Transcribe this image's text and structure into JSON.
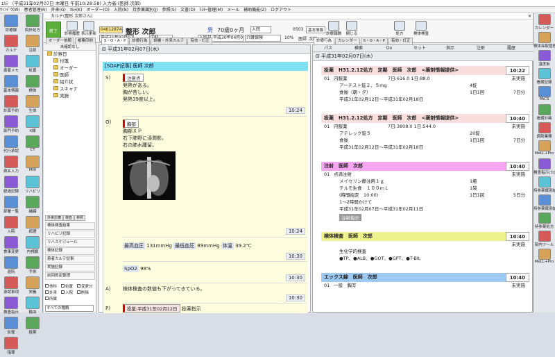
{
  "app": {
    "title": "ｴﾙﾃ （平成31年02月07日 木曜日 午前10:28:58) 入力者:(医師 次郎)",
    "menu": [
      "ｳｨﾝﾄﾞｳ(W)",
      "患者管理(R)",
      "外来(G)",
      "ｶﾙﾃ(K)",
      "オーダー(O)",
      "入院(N)",
      "持参薬識別(J)",
      "参照(S)",
      "文書(D)",
      "ﾏｽﾀｰ管理(M)",
      "メール",
      "補助機能(Z)",
      "ログアウト"
    ]
  },
  "left_tools": [
    "診療録",
    "院外処方",
    "カルテ",
    "注射",
    "患者メモ",
    "処置",
    "基本情報",
    "検体",
    "計算予約",
    "生体",
    "部門予約",
    "X線",
    "代行承認",
    "CT",
    "病名入力",
    "MRI",
    "経過記録",
    "リハビリ",
    "部署一覧",
    "補綴",
    "入院",
    "病理",
    "食事変更",
    "内視鏡",
    "退院",
    "手術",
    "承認事項",
    "栄養",
    "検査指示",
    "輸血",
    "反復",
    "投薬",
    "指導"
  ],
  "right_tools": [
    "カレンダー",
    "検体採取管理",
    "温度板",
    "看護記録",
    "PACS",
    "看護計画",
    "調剤業務",
    "MeLL+Pro",
    "検査指示(カ)",
    "持参薬識別結果",
    "持参薬識別結果中止",
    "持参薬処方",
    "院内ツール",
    "MeLL+Pro"
  ],
  "window": {
    "title": "カルテ(整形 次郎さん)"
  },
  "patient": {
    "id": "04012874",
    "name": "整形 次郎",
    "sex": "男",
    "age": "70歳0ヶ月",
    "dept": "内科",
    "status": "入院",
    "admit": "入院日:平成30年04月01日",
    "insurance": "介護保険",
    "ratio": "10%",
    "room": "0503",
    "role": "医師",
    "doctor": "次郎",
    "date": "平成31年02月07日"
  },
  "toolbar": {
    "end": "終了",
    "save": "診察履歴",
    "display": "表示更新",
    "basic": "基本情報",
    "fee": "診療報酬",
    "close": "閉じる",
    "body": "検体検査",
    "rx": "処方",
    "extra": "有効・訂正"
  },
  "tree": {
    "header": "未確認なし",
    "items": [
      "診察日",
      "付箋",
      "オーダー",
      "医師",
      "紹介状",
      "スキャナ",
      "実施"
    ],
    "left_tabs": [
      "オーダー依頼",
      "帳票印刷"
    ],
    "bottom_tabs": [
      "外来診療",
      "検査",
      "参照"
    ],
    "bottom_list": [
      "検体検査結果",
      "リハビリ記録",
      "リハスケジュール",
      "検体記録",
      "患者カルテ記事",
      "実施記録",
      "前回設定整理"
    ],
    "checks": [
      "他科",
      "処置",
      "変更分",
      "外来",
      "入院",
      "削除",
      "所属"
    ],
    "filter": "すべての種類"
  },
  "center": {
    "tabs": [
      "S・O・A・P",
      "診療行為",
      "調書・外来カルテ",
      "有効・訂正"
    ],
    "date": "平成31年02月07日(木)",
    "header": "[SOAP記事] 医師  次郎",
    "s_tag": "注意点",
    "s_lines": [
      "発熱がある。",
      "胸が苦しい。",
      "発熱39度以上。"
    ],
    "s_time": "10:24",
    "o_tag": "胸部",
    "o_lines": [
      "胸部ＸＰ",
      "右下肺野に浸潤影。",
      "右の肺水腫留。"
    ],
    "o_time": "10:24",
    "vitals": {
      "bp_hi_label": "最高血圧",
      "bp_hi": "131mmHg",
      "bp_lo_label": "最低血圧",
      "bp_lo": "89mmHg",
      "temp_label": "体温",
      "temp": "39.2℃"
    },
    "v_time": "10:30",
    "spo2_label": "SpO2",
    "spo2": "98%",
    "spo2_time": "10:30",
    "a_text": "検体検査の数値も下がってきている。",
    "a_time": "10:30",
    "p_order": "投薬:平成31年02月12日",
    "p_text": "投薬指示"
  },
  "right": {
    "tabs": [
      "診療行為",
      "カレンダー",
      "S・O・A・P",
      "有効・訂正"
    ],
    "cols": [
      "パス",
      "検索",
      "Do",
      "セット",
      "指示",
      "注射",
      "履歴"
    ],
    "date": "平成31年02月07日(木)",
    "orders": [
      {
        "title": "投薬　H31.2.12処方　定期　医師　次郎　<薬剤情報提供>",
        "time": "10:22",
        "color": "#f9dede",
        "lines": [
          [
            "01",
            "内服薬",
            "7日:616.0 1日:88.0",
            "",
            "未実施"
          ],
          [
            "",
            "アーチスト錠２．５mg",
            "",
            "4錠",
            ""
          ],
          [
            "",
            "食後（朝・夕）",
            "",
            "1日1回",
            "7日分"
          ],
          [
            "",
            "平成31年02月12日～平成31年02月18日",
            "",
            "",
            ""
          ]
        ]
      },
      {
        "title": "投薬　H31.2.12処方　定期　医師　次郎　<薬剤情報提供>",
        "time": "10:40",
        "color": "#f9dede",
        "lines": [
          [
            "01",
            "内服薬",
            "7日:3808.0 1日:544.0",
            "",
            "未実施"
          ],
          [
            "",
            "アテレック錠５",
            "",
            "20錠",
            ""
          ],
          [
            "",
            "食後",
            "",
            "1日1回",
            "7日分"
          ],
          [
            "",
            "平成31年02月12日～平成31年02月18日",
            "",
            "",
            ""
          ]
        ]
      },
      {
        "title": "注射　医師　次郎",
        "time": "10:40",
        "color": "#f7a6f2",
        "lines": [
          [
            "01",
            "点滴注射",
            "",
            "",
            "未実施"
          ],
          [
            "",
            "メイセリン静注用１ｇ",
            "",
            "1瓶",
            ""
          ],
          [
            "",
            "テルモ生食　１００ｍＬ",
            "",
            "1袋",
            ""
          ],
          [
            "",
            "(時間指定　10:00)",
            "",
            "1日1回",
            "5日分"
          ],
          [
            "",
            "1～2時間かけて",
            "",
            "",
            ""
          ],
          [
            "",
            "平成31年02月07日～平成31年02月11日",
            "",
            "",
            ""
          ]
        ],
        "button": "注射指示"
      },
      {
        "title": "検体検査　医師　次郎",
        "time": "10:40",
        "color": "#eef28c",
        "lines": [
          [
            "",
            "",
            "",
            "",
            "未実施"
          ],
          [
            "",
            "生化学的検査",
            "",
            "",
            ""
          ],
          [
            "",
            "●TP、●ALB、●GOT、●GPT、●T-BIL",
            "",
            "",
            ""
          ]
        ]
      },
      {
        "title": "エックス線　医師　次郎",
        "time": "10:40",
        "color": "#9dc9f2",
        "lines": [
          [
            "01",
            "一般　胸写",
            "",
            "",
            "未実施"
          ]
        ]
      }
    ]
  }
}
